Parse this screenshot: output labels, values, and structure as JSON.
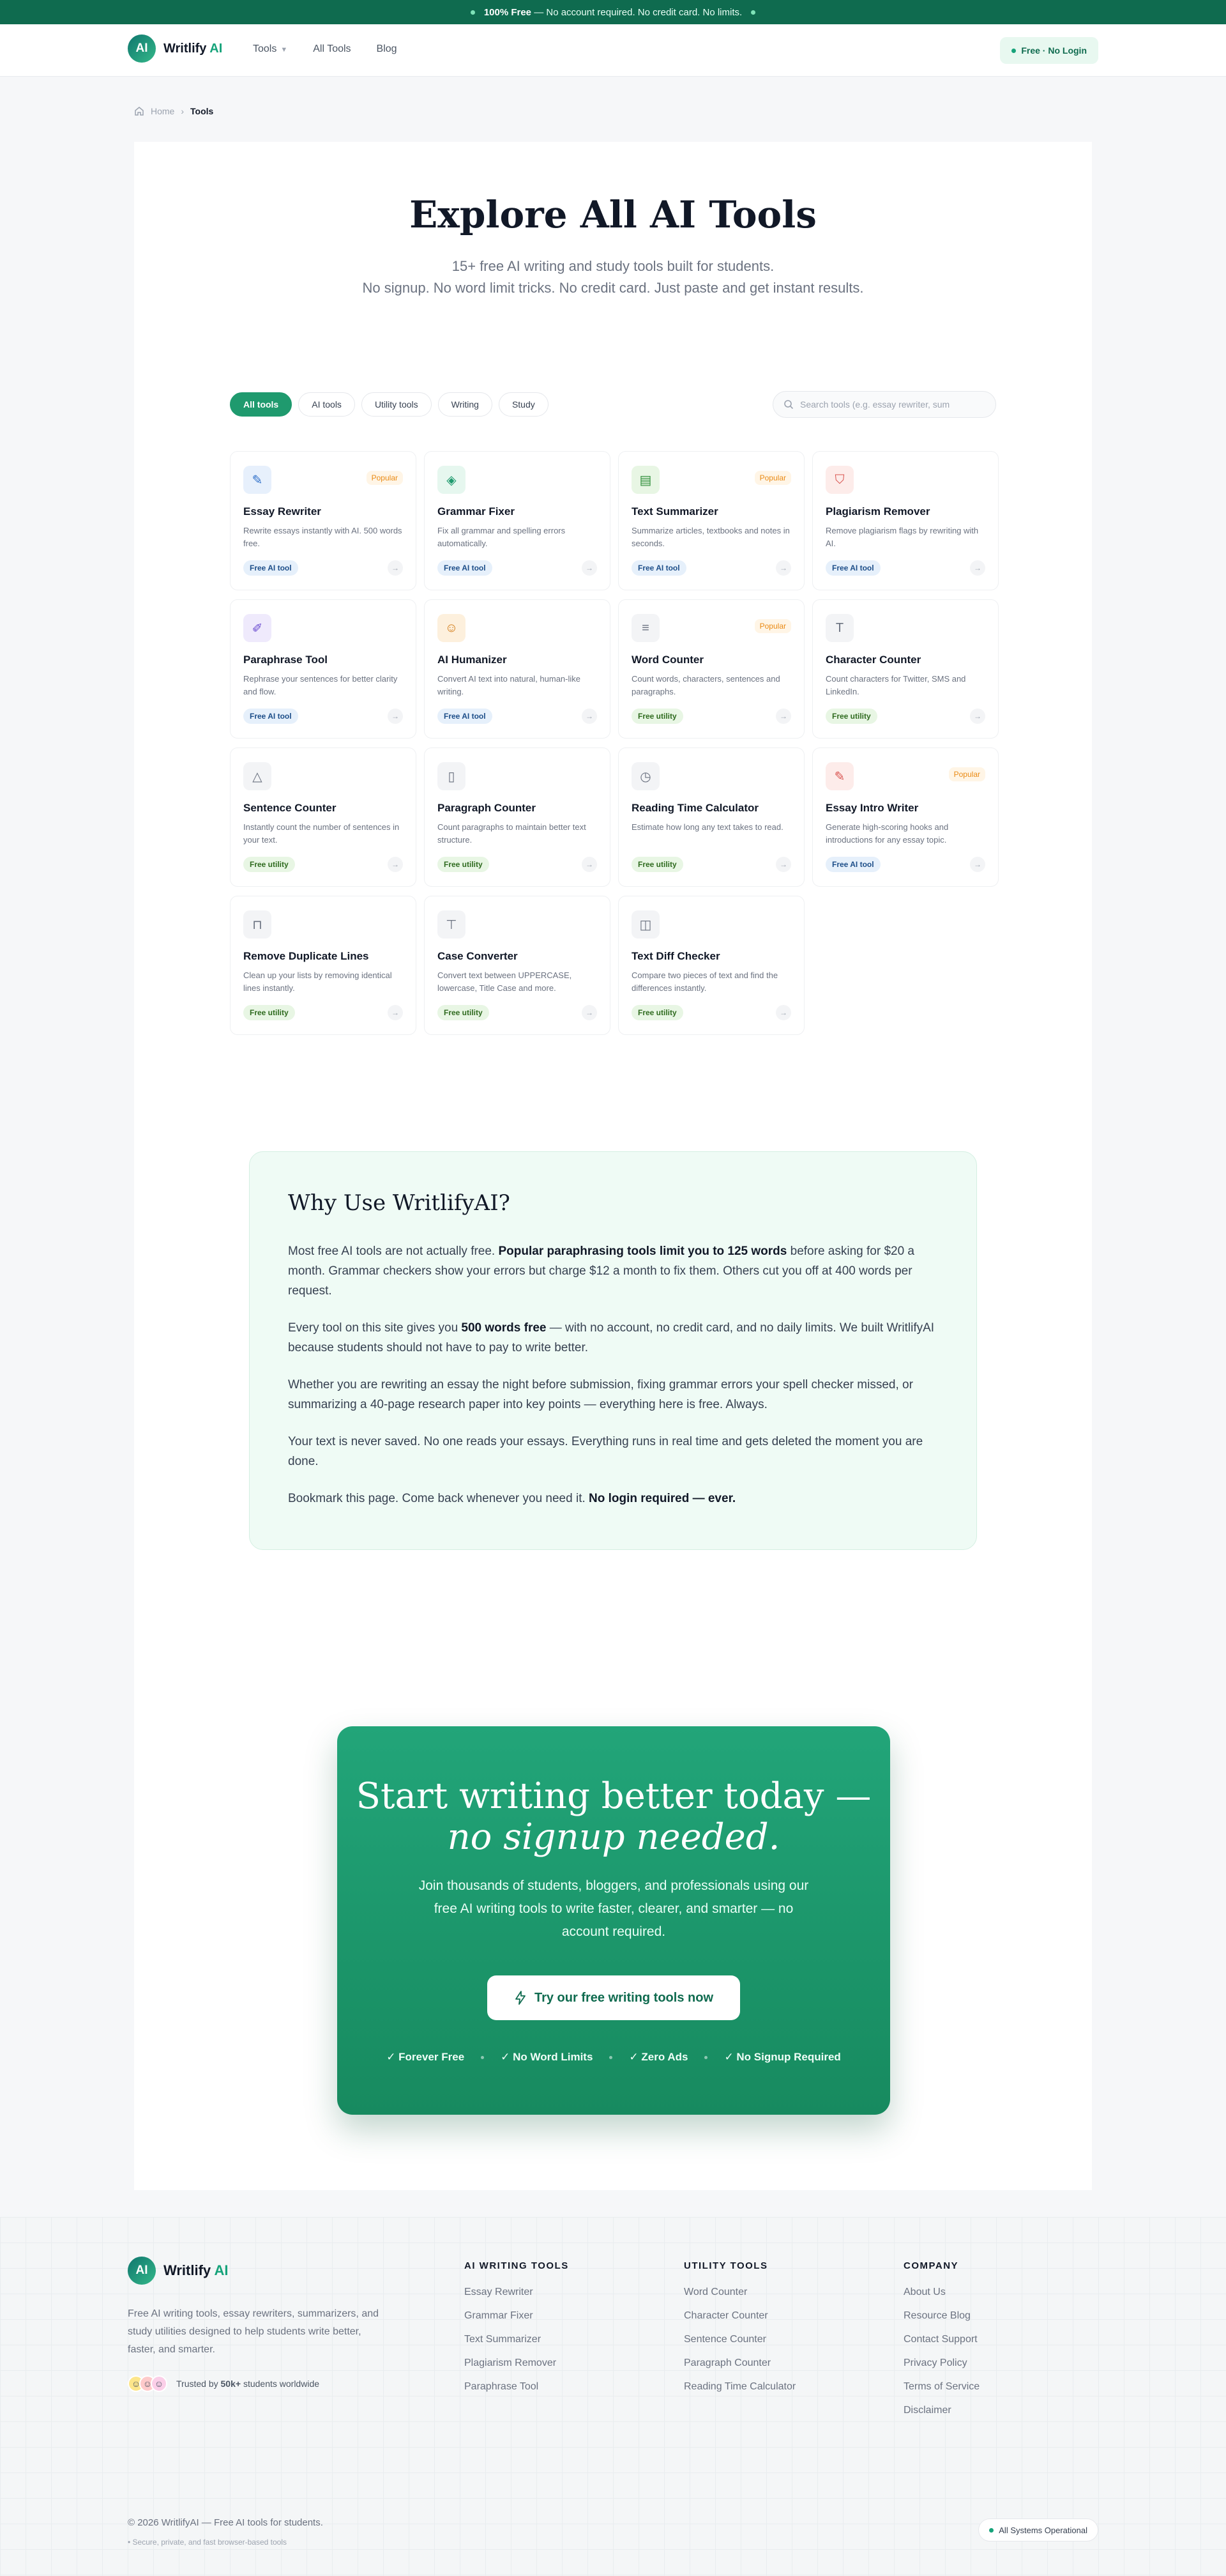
{
  "banner": {
    "strong": "100% Free",
    "text": "— No account required. No credit card. No limits."
  },
  "header": {
    "logo_mark": "AI",
    "logo_name": "Writlify",
    "logo_ai": "AI",
    "nav": {
      "tools": "Tools",
      "all_tools": "All Tools",
      "blog": "Blog"
    },
    "free_pill": "Free · No Login"
  },
  "breadcrumb": {
    "home": "Home",
    "current": "Tools"
  },
  "hero": {
    "title": "Explore All AI Tools",
    "line1": "15+ free AI writing and study tools built for students.",
    "line2": "No signup. No word limit tricks. No credit card. Just paste and get instant results."
  },
  "filters": [
    "All tools",
    "AI tools",
    "Utility tools",
    "Writing",
    "Study"
  ],
  "search": {
    "placeholder": "Search tools (e.g. essay rewriter, sum"
  },
  "tools": [
    {
      "name": "Essay Rewriter",
      "desc": "Rewrite essays instantly with AI. 500 words free.",
      "badge": "Free AI tool",
      "popular": "Popular",
      "icon": "edit-icon",
      "glyph": "✎",
      "color": "#2f6fc9",
      "bg": "#e7f0fc",
      "type": "ai"
    },
    {
      "name": "Grammar Fixer",
      "desc": "Fix all grammar and spelling errors automatically.",
      "badge": "Free AI tool",
      "popular": "",
      "icon": "layers-icon",
      "glyph": "◈",
      "color": "#1f9a6e",
      "bg": "#e6f7ef",
      "type": "ai"
    },
    {
      "name": "Text Summarizer",
      "desc": "Summarize articles, textbooks and notes in seconds.",
      "badge": "Free AI tool",
      "popular": "Popular",
      "icon": "document-icon",
      "glyph": "▤",
      "color": "#2f8f3a",
      "bg": "#e8f6e4",
      "type": "ai"
    },
    {
      "name": "Plagiarism Remover",
      "desc": "Remove plagiarism flags by rewriting with AI.",
      "badge": "Free AI tool",
      "popular": "",
      "icon": "shield-icon",
      "glyph": "⛉",
      "color": "#d9534f",
      "bg": "#fdecea",
      "type": "ai"
    },
    {
      "name": "Paraphrase Tool",
      "desc": "Rephrase your sentences for better clarity and flow.",
      "badge": "Free AI tool",
      "popular": "",
      "icon": "pen-icon",
      "glyph": "✐",
      "color": "#6d4fd1",
      "bg": "#efeafc",
      "type": "ai"
    },
    {
      "name": "AI Humanizer",
      "desc": "Convert AI text into natural, human-like writing.",
      "badge": "Free AI tool",
      "popular": "",
      "icon": "user-icon",
      "glyph": "☺",
      "color": "#d27a14",
      "bg": "#fdf0dd",
      "type": "ai"
    },
    {
      "name": "Word Counter",
      "desc": "Count words, characters, sentences and paragraphs.",
      "badge": "Free utility",
      "popular": "Popular",
      "icon": "text-lines-icon",
      "glyph": "≡",
      "color": "#6b7280",
      "bg": "#f3f4f6",
      "type": "util"
    },
    {
      "name": "Character Counter",
      "desc": "Count characters for Twitter, SMS and LinkedIn.",
      "badge": "Free utility",
      "popular": "",
      "icon": "type-icon",
      "glyph": "T",
      "color": "#6b7280",
      "bg": "#f3f4f6",
      "type": "util"
    },
    {
      "name": "Sentence Counter",
      "desc": "Instantly count the number of sentences in your text.",
      "badge": "Free utility",
      "popular": "",
      "icon": "triangle-icon",
      "glyph": "△",
      "color": "#6b7280",
      "bg": "#f3f4f6",
      "type": "util"
    },
    {
      "name": "Paragraph Counter",
      "desc": "Count paragraphs to maintain better text structure.",
      "badge": "Free utility",
      "popular": "",
      "icon": "file-icon",
      "glyph": "▯",
      "color": "#6b7280",
      "bg": "#f3f4f6",
      "type": "util"
    },
    {
      "name": "Reading Time Calculator",
      "desc": "Estimate how long any text takes to read.",
      "badge": "Free utility",
      "popular": "",
      "icon": "clock-icon",
      "glyph": "◷",
      "color": "#6b7280",
      "bg": "#f3f4f6",
      "type": "util"
    },
    {
      "name": "Essay Intro Writer",
      "desc": "Generate high-scoring hooks and introductions for any essay topic.",
      "badge": "Free AI tool",
      "popular": "Popular",
      "icon": "edit-square-icon",
      "glyph": "✎",
      "color": "#d9534f",
      "bg": "#fdecea",
      "type": "ai"
    },
    {
      "name": "Remove Duplicate Lines",
      "desc": "Clean up your lists by removing identical lines instantly.",
      "badge": "Free utility",
      "popular": "",
      "icon": "lock-icon",
      "glyph": "⊓",
      "color": "#6b7280",
      "bg": "#f3f4f6",
      "type": "util"
    },
    {
      "name": "Case Converter",
      "desc": "Convert text between UPPERCASE, lowercase, Title Case and more.",
      "badge": "Free utility",
      "popular": "",
      "icon": "filter-icon",
      "glyph": "⊤",
      "color": "#6b7280",
      "bg": "#f3f4f6",
      "type": "util"
    },
    {
      "name": "Text Diff Checker",
      "desc": "Compare two pieces of text and find the differences instantly.",
      "badge": "Free utility",
      "popular": "",
      "icon": "diff-icon",
      "glyph": "◫",
      "color": "#6b7280",
      "bg": "#f3f4f6",
      "type": "util"
    }
  ],
  "why": {
    "title": "Why Use WritlifyAI?",
    "p1a": "Most free AI tools are not actually free. ",
    "p1b": "Popular paraphrasing tools limit you to 125 words",
    "p1c": " before asking for $20 a month. Grammar checkers show your errors but charge $12 a month to fix them. Others cut you off at 400 words per request.",
    "p2a": "Every tool on this site gives you ",
    "p2b": "500 words free",
    "p2c": " — with no account, no credit card, and no daily limits. We built WritlifyAI because students should not have to pay to write better.",
    "p3": "Whether you are rewriting an essay the night before submission, fixing grammar errors your spell checker missed, or summarizing a 40-page research paper into key points — everything here is free. Always.",
    "p4": "Your text is never saved. No one reads your essays. Everything runs in real time and gets deleted the moment you are done.",
    "p5a": "Bookmark this page. Come back whenever you need it. ",
    "p5b": "No login required — ever."
  },
  "cta": {
    "title_line1": "Start writing better today —",
    "title_line2": "no signup needed.",
    "desc": "Join thousands of students, bloggers, and professionals using our free AI writing tools to write faster, clearer, and smarter — no account required.",
    "button": "Try our free writing tools now",
    "features": [
      "Forever Free",
      "No Word Limits",
      "Zero Ads",
      "No Signup Required"
    ]
  },
  "footer": {
    "desc": "Free AI writing tools, essay rewriters, summarizers, and study utilities designed to help students write better, faster, and smarter.",
    "trust_prefix": "Trusted by",
    "trust_count": "50k+",
    "trust_suffix": "students worldwide",
    "columns": [
      {
        "title": "AI WRITING TOOLS",
        "links": [
          "Essay Rewriter",
          "Grammar Fixer",
          "Text Summarizer",
          "Plagiarism Remover",
          "Paraphrase Tool"
        ]
      },
      {
        "title": "UTILITY TOOLS",
        "links": [
          "Word Counter",
          "Character Counter",
          "Sentence Counter",
          "Paragraph Counter",
          "Reading Time Calculator"
        ]
      },
      {
        "title": "COMPANY",
        "links": [
          "About Us",
          "Resource Blog",
          "Contact Support",
          "Privacy Policy",
          "Terms of Service",
          "Disclaimer"
        ]
      }
    ],
    "copyright": "© 2026 WritlifyAI — Free AI tools for students.",
    "subline": "Secure, private, and fast browser-based tools",
    "status": "All Systems Operational"
  },
  "colors": {
    "brand": "#1f9a6e",
    "brand_dark": "#0f6b4f",
    "popular": "#ea8a14"
  }
}
